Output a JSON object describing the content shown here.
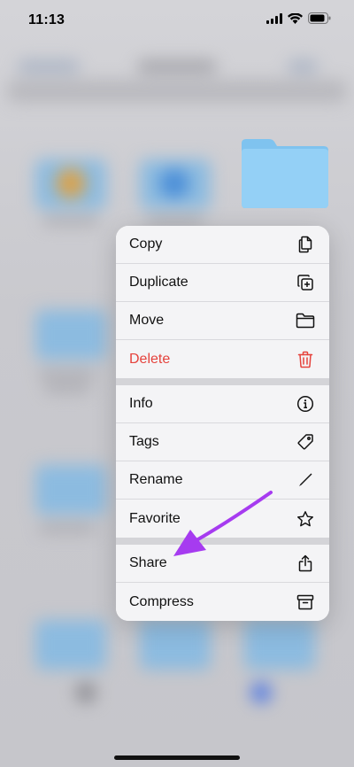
{
  "status_bar": {
    "time": "11:13"
  },
  "menu": {
    "groups": [
      [
        {
          "label": "Copy",
          "icon": "copy-icon"
        },
        {
          "label": "Duplicate",
          "icon": "duplicate-icon"
        },
        {
          "label": "Move",
          "icon": "folder-icon"
        },
        {
          "label": "Delete",
          "icon": "trash-icon",
          "destructive": true
        }
      ],
      [
        {
          "label": "Info",
          "icon": "info-icon"
        },
        {
          "label": "Tags",
          "icon": "tag-icon"
        },
        {
          "label": "Rename",
          "icon": "pencil-icon"
        },
        {
          "label": "Favorite",
          "icon": "star-icon"
        }
      ],
      [
        {
          "label": "Share",
          "icon": "share-icon"
        },
        {
          "label": "Compress",
          "icon": "archive-icon"
        }
      ]
    ]
  },
  "colors": {
    "destructive": "#e5423c",
    "folder": "#8ecdf5",
    "annotation_arrow": "#a63bf0"
  }
}
